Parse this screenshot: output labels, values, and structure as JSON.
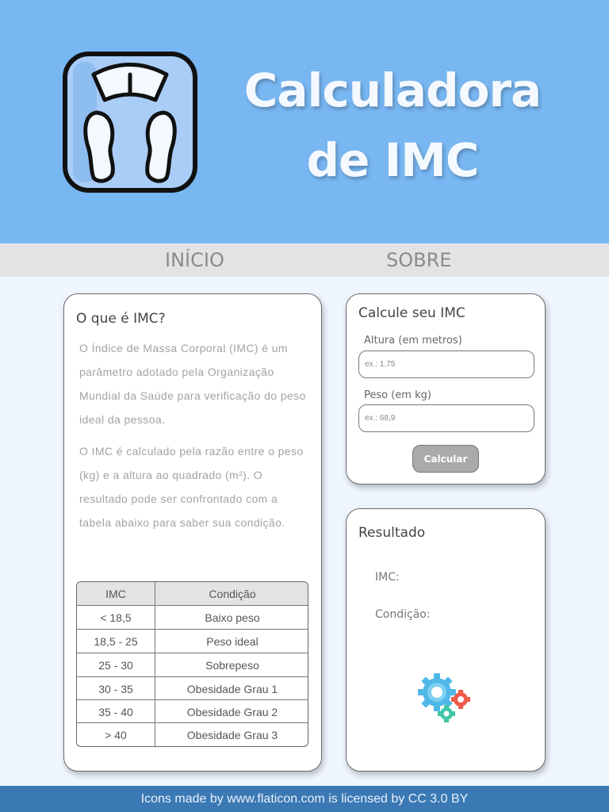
{
  "header": {
    "logo_icon": "weighing-scale-icon",
    "title_line1": "Calculadora",
    "title_line2": "de IMC"
  },
  "nav": {
    "inicio": "INÍCIO",
    "sobre": "SOBRE"
  },
  "info": {
    "title": "O que é IMC?",
    "paragraph1": "O Índice de Massa Corporal (IMC) é um parâmetro adotado pela Organização Mundial da Saúde para verificação do peso ideal da pessoa.",
    "paragraph2": "O IMC é calculado pela razão entre o peso (kg) e a altura ao quadrado (m²). O resultado pode ser confrontado com a tabela abaixo para saber sua condição.",
    "table": {
      "headers": [
        "IMC",
        "Condição"
      ],
      "rows": [
        [
          "< 18,5",
          "Baixo peso"
        ],
        [
          "18,5 - 25",
          "Peso ideal"
        ],
        [
          "25 - 30",
          "Sobrepeso"
        ],
        [
          "30 - 35",
          "Obesidade Grau 1"
        ],
        [
          "35 - 40",
          "Obesidade Grau 2"
        ],
        [
          "> 40",
          "Obesidade Grau 3"
        ]
      ]
    }
  },
  "calc": {
    "title": "Calcule seu IMC",
    "altura_label": "Altura (em metros)",
    "altura_placeholder": "ex.: 1,75",
    "altura_value": "",
    "peso_label": "Peso (em kg)",
    "peso_placeholder": "ex.: 68,9",
    "peso_value": "",
    "button_label": "Calcular"
  },
  "result": {
    "title": "Resultado",
    "imc_label": "IMC:",
    "condicao_label": "Condição:",
    "icon": "gears-icon"
  },
  "footer": {
    "text": "Icons made by www.flaticon.com is licensed by CC 3.0 BY"
  },
  "colors": {
    "header_bg": "#78b7f2",
    "nav_bg": "#e3e3e3",
    "page_bg": "#f0f6ff",
    "footer_bg": "#3a79b4",
    "button_bg": "#aaaaaa"
  }
}
